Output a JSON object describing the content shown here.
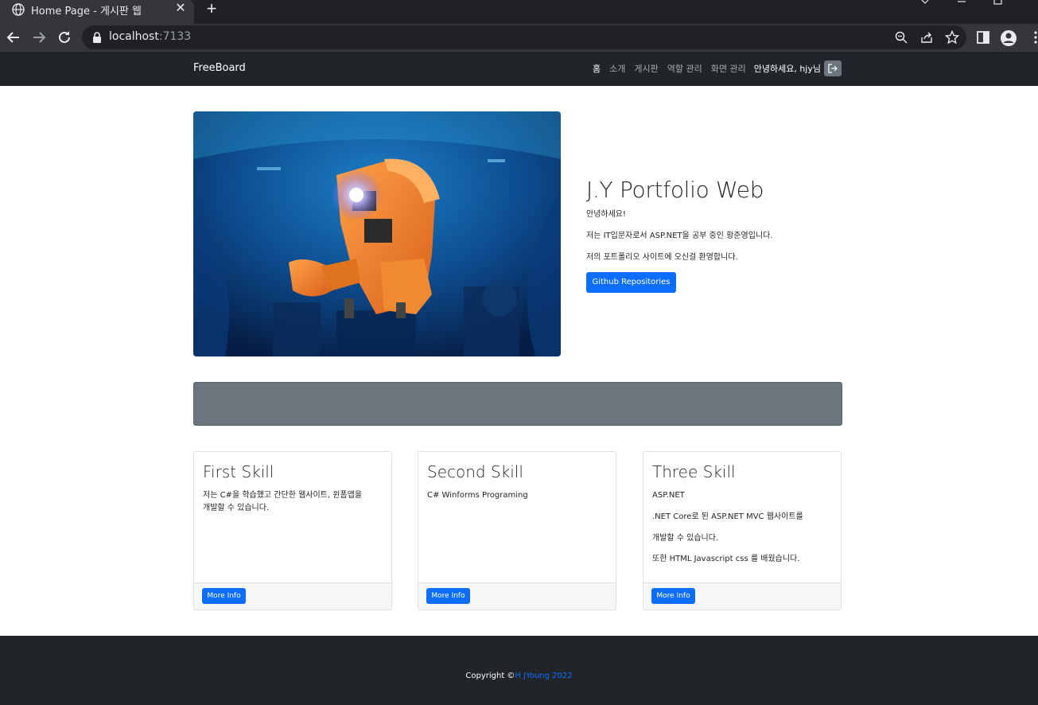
{
  "browser": {
    "tab_title": "Home Page - 게시판 웹",
    "tab_close": "✕",
    "new_tab": "+",
    "url_host": "localhost",
    "url_port": ":7133"
  },
  "navbar": {
    "brand": "FreeBoard",
    "links": [
      "홈",
      "소개",
      "게시판",
      "역할 관리",
      "화면 관리"
    ],
    "greeting": "안녕하세요, hjy님"
  },
  "hero": {
    "title": "J.Y Portfolio Web",
    "line1": "안녕하세요!",
    "line2": "저는 IT입문자로서 ASP.NET을 공부 중인 황준영입니다.",
    "line3": "저의 포트폴리오 사이트에 오신걸 환영합니다.",
    "button": "Github Repositories",
    "image_alt": "orange underwater robot"
  },
  "cards": [
    {
      "title": "First Skill",
      "lines": [
        "저는 C#을 학습했고 간단한 웹사이트, 윈폼앱을",
        "개발할 수 있습니다."
      ],
      "button": "More Info"
    },
    {
      "title": "Second Skill",
      "lines": [
        "C# Winforms Programing"
      ],
      "button": "More Info"
    },
    {
      "title": "Three Skill",
      "lines": [
        "ASP.NET",
        ".NET Core로 된 ASP.NET MVC 웹사이트를",
        "개발할 수 있습니다.",
        "또한 HTML Javascript css 를 배웠습니다."
      ],
      "button": "More Info"
    }
  ],
  "footer": {
    "copyright": "Copyright ©",
    "author": "H JYoung 2022"
  },
  "colors": {
    "primary": "#0d6efd",
    "navbar_bg": "#212529",
    "banner_bg": "#6c757d"
  }
}
